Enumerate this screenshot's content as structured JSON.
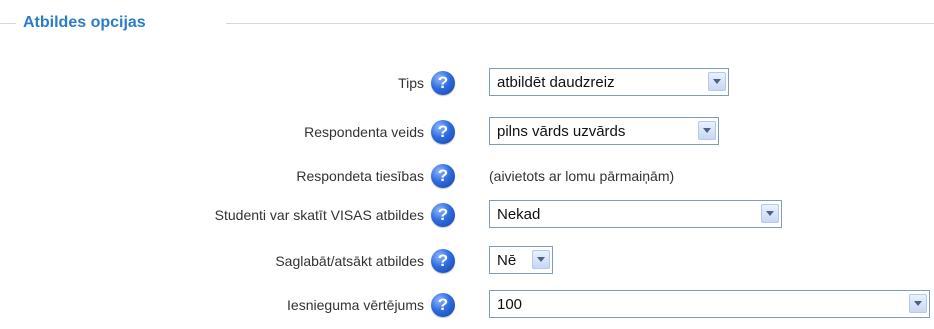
{
  "section": {
    "title": "Atbildes opcijas"
  },
  "fields": [
    {
      "label": "Tips",
      "type": "select",
      "value": "atbildēt daudzreiz"
    },
    {
      "label": "Respondenta veids",
      "type": "select",
      "value": "pilns vārds uzvārds"
    },
    {
      "label": "Respondeta tiesības",
      "type": "text",
      "value": "(aivietots ar lomu pārmaiņām)"
    },
    {
      "label": "Studenti var skatīt VISAS atbildes",
      "type": "select",
      "value": "Nekad"
    },
    {
      "label": "Saglabāt/atsākt atbildes",
      "type": "select",
      "value": "Nē"
    },
    {
      "label": "Iesnieguma vērtējums",
      "type": "select",
      "value": "100"
    }
  ],
  "icons": {
    "help": "help-question-icon",
    "dropdown": "chevron-down-icon"
  },
  "colors": {
    "title": "#2a7dc8",
    "help_icon": "#2f6de0",
    "select_border": "#7f9db9",
    "label": "#333333"
  }
}
